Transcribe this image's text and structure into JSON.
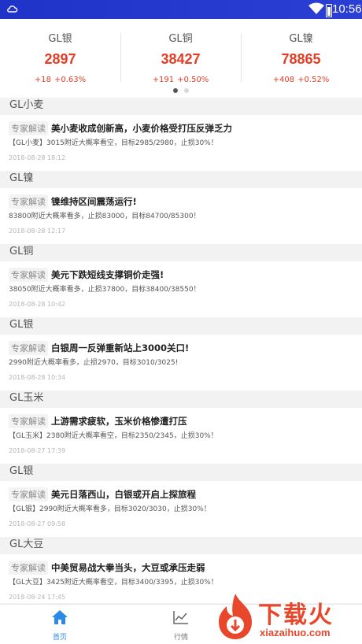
{
  "status_bar": {
    "time": "10:56"
  },
  "ticker": [
    {
      "name": "GL银",
      "price": "2897",
      "change": "+18",
      "percent": "+0.63%"
    },
    {
      "name": "GL铜",
      "price": "38427",
      "change": "+191",
      "percent": "+0.50%"
    },
    {
      "name": "GL镍",
      "price": "78865",
      "change": "+408",
      "percent": "+0.52%"
    }
  ],
  "feed": [
    {
      "section": "GL小麦",
      "tag": "专家解读",
      "title": "美小麦收成创新高，小麦价格受打压反弹乏力",
      "summary": "【GL小麦】3015附近大概率看空，目标2985/2980，止损30%！",
      "date": "2018-08-28 18:12"
    },
    {
      "section": "GL镍",
      "tag": "专家解读",
      "title": "镍维持区间震荡运行!",
      "summary": "83800附近大概率看多，止损83000，目标84700/85300！",
      "date": "2018-08-28 12:17"
    },
    {
      "section": "GL铜",
      "tag": "专家解读",
      "title": "美元下跌短线支撑铜价走强!",
      "summary": "38050附近大概率看多，止损37800，目标38400/38550！",
      "date": "2018-08-28 10:42"
    },
    {
      "section": "GL银",
      "tag": "专家解读",
      "title": "白银周一反弹重新站上3000关口!",
      "summary": "2990附近大概率看多，止损2970，目标3010/3025!",
      "date": "2018-08-28 10:34"
    },
    {
      "section": "GL玉米",
      "tag": "专家解读",
      "title": "上游需求疲软，玉米价格惨遭打压",
      "summary": "【GL玉米】2380附近大概率看空，目标2350/2345，止损30%！",
      "date": "2018-08-27 17:39"
    },
    {
      "section": "GL银",
      "tag": "专家解读",
      "title": "美元日落西山，白银或开启上探旅程",
      "summary": "【GL银】2990附近大概率看多，目标3020/3030，止损30%！",
      "date": "2018-08-27 09:58"
    },
    {
      "section": "GL大豆",
      "tag": "专家解读",
      "title": "中美贸易战大拳当头，大豆或承压走弱",
      "summary": "【GL大豆】3425附近大概率看空，目标3400/3395，止损30%！",
      "date": "2018-08-24 17:45"
    }
  ],
  "tabbar": [
    {
      "label": "首页",
      "icon": "home-icon",
      "active": true
    },
    {
      "label": "行情",
      "icon": "chart-icon",
      "active": false
    }
  ],
  "watermark": {
    "text": "下载火",
    "domain": "xiazaihuo.com"
  },
  "colors": {
    "status_bar": "#1f33c9",
    "up": "#e63c24",
    "active_tab": "#2b8ae8"
  }
}
